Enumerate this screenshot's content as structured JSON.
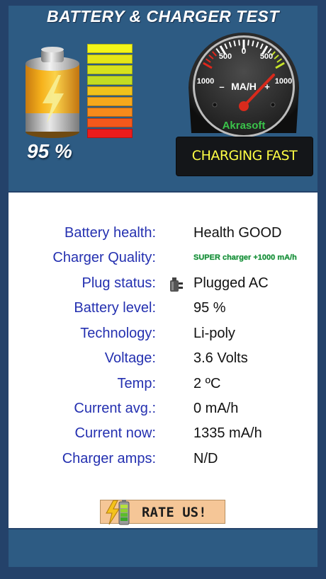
{
  "app": {
    "title": "BATTERY & CHARGER TEST"
  },
  "battery": {
    "percent_text": "95 %",
    "level_fraction": 0.95
  },
  "level_bars": [
    "#f3f518",
    "#e5e617",
    "#d7e21c",
    "#c4dc22",
    "#f0c21c",
    "#f6a81c",
    "#f68a1c",
    "#f4581c",
    "#ec1c1c"
  ],
  "gauge": {
    "ticks": {
      "left_500": "500",
      "zero": "0",
      "right_500": "500",
      "left_1000": "1000",
      "right_1000": "1000"
    },
    "minus": "–",
    "plus": "+",
    "unit": "MA/H",
    "brand": "Akrasoft",
    "value": 1335
  },
  "charging_status": "CHARGING FAST",
  "info": [
    {
      "label": "Battery health:",
      "value": "Health GOOD"
    },
    {
      "label": "Charger Quality:",
      "value": "SUPER charger +1000 mA/h"
    },
    {
      "label": "Plug status:",
      "value": "Plugged AC"
    },
    {
      "label": "Battery level:",
      "value": "95 %"
    },
    {
      "label": "Technology:",
      "value": "Li-poly"
    },
    {
      "label": "Voltage:",
      "value": "3.6 Volts"
    },
    {
      "label": "Temp:",
      "value": "2 ºC"
    },
    {
      "label": "Current avg.:",
      "value": "0 mA/h"
    },
    {
      "label": "Current now:",
      "value": "1335 mA/h"
    },
    {
      "label": "Charger amps:",
      "value": "N/D"
    }
  ],
  "rate_button": {
    "label": "RATE US!"
  },
  "icons": {
    "battery": "battery-charging-icon",
    "plug": "plug-icon",
    "rate": "battery-bolt-icon"
  },
  "colors": {
    "label_blue": "#2430b0",
    "quality_green": "#1a8a3a",
    "status_yellow": "#ffff44"
  }
}
